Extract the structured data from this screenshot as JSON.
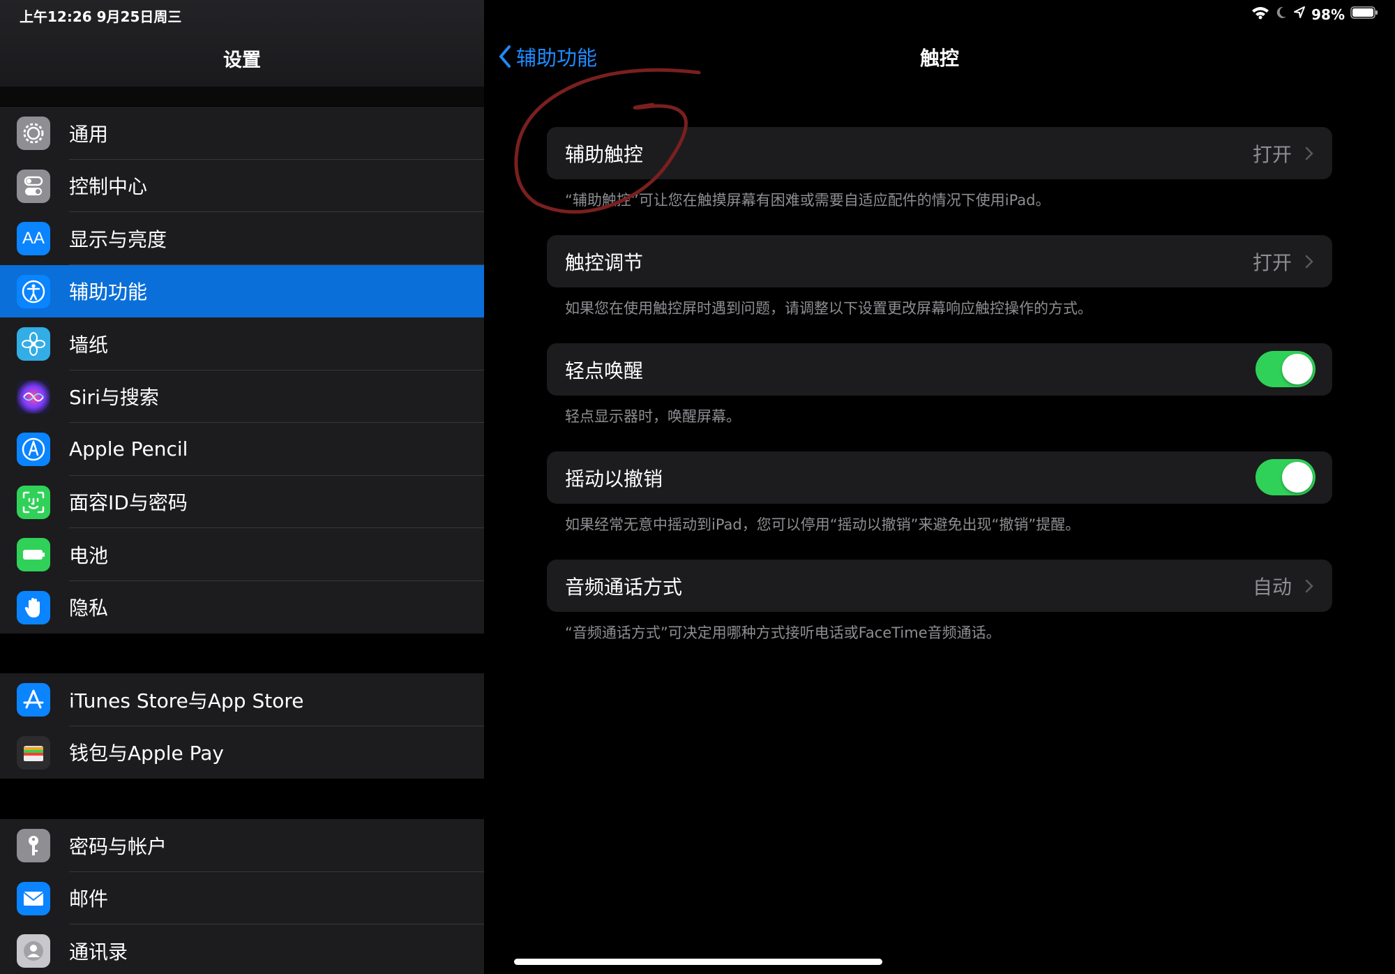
{
  "status_bar": {
    "time_date": "上午12:26   9月25日周三",
    "battery": "98%"
  },
  "sidebar": {
    "title": "设置",
    "groups": [
      {
        "items": [
          {
            "label": "通用",
            "icon": "gear-icon",
            "color": "#8e8e93"
          },
          {
            "label": "控制中心",
            "icon": "toggles-icon",
            "color": "#8e8e93"
          },
          {
            "label": "显示与亮度",
            "icon": "text-size-icon",
            "color": "#0a84ff"
          },
          {
            "label": "辅助功能",
            "icon": "accessibility-icon",
            "color": "#0a84ff",
            "selected": true
          },
          {
            "label": "墙纸",
            "icon": "flower-icon",
            "color": "#32ade6"
          },
          {
            "label": "Siri与搜索",
            "icon": "siri-icon",
            "color": "#1c1c3a"
          },
          {
            "label": "Apple Pencil",
            "icon": "pencil-icon",
            "color": "#0a84ff"
          },
          {
            "label": "面容ID与密码",
            "icon": "face-id-icon",
            "color": "#30d158"
          },
          {
            "label": "电池",
            "icon": "battery-icon",
            "color": "#30d158"
          },
          {
            "label": "隐私",
            "icon": "hand-icon",
            "color": "#0a84ff"
          }
        ]
      },
      {
        "items": [
          {
            "label": "iTunes Store与App Store",
            "icon": "app-store-icon",
            "color": "#0a84ff"
          },
          {
            "label": "钱包与Apple Pay",
            "icon": "wallet-icon",
            "color": "#1c1c1e"
          }
        ]
      },
      {
        "items": [
          {
            "label": "密码与帐户",
            "icon": "key-icon",
            "color": "#8e8e93"
          },
          {
            "label": "邮件",
            "icon": "mail-icon",
            "color": "#0a84ff"
          },
          {
            "label": "通讯录",
            "icon": "contacts-icon",
            "color": "#8e8e93"
          }
        ]
      }
    ]
  },
  "detail": {
    "back_label": "辅助功能",
    "title": "触控",
    "cells": [
      {
        "label": "辅助触控",
        "value": "打开",
        "type": "disclosure",
        "footer": "“辅助触控”可让您在触摸屏幕有困难或需要自适应配件的情况下使用iPad。"
      },
      {
        "label": "触控调节",
        "value": "打开",
        "type": "disclosure",
        "footer": "如果您在使用触控屏时遇到问题，请调整以下设置更改屏幕响应触控操作的方式。"
      },
      {
        "label": "轻点唤醒",
        "type": "toggle",
        "on": true,
        "footer": "轻点显示器时，唤醒屏幕。"
      },
      {
        "label": "摇动以撤销",
        "type": "toggle",
        "on": true,
        "footer": "如果经常无意中摇动到iPad，您可以停用“摇动以撤销”来避免出现“撤销”提醒。"
      },
      {
        "label": "音频通话方式",
        "value": "自动",
        "type": "disclosure",
        "footer": "“音频通话方式”可决定用哪种方式接听电话或FaceTime音频通话。"
      }
    ]
  },
  "colors": {
    "accent": "#0a84ff",
    "toggle_on": "#30d158",
    "annotation": "#7a1f1f"
  }
}
